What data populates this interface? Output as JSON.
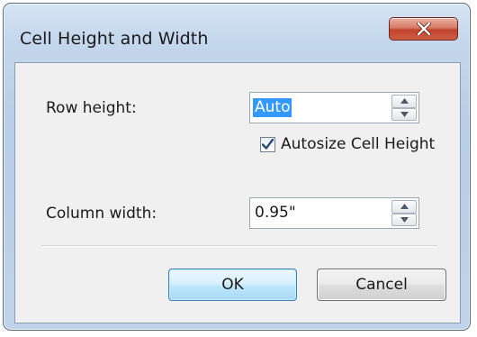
{
  "dialog": {
    "title": "Cell Height and Width"
  },
  "row_height": {
    "label": "Row height:",
    "value": "Auto",
    "selected": true
  },
  "autosize": {
    "label": "Autosize Cell Height",
    "checked": true
  },
  "column_width": {
    "label": "Column width:",
    "value": "0.95\""
  },
  "buttons": {
    "ok_label": "OK",
    "cancel_label": "Cancel"
  },
  "icons": {
    "close": "close-icon",
    "spin_up": "spin-up-icon",
    "spin_down": "spin-down-icon",
    "check": "checkmark-icon"
  },
  "colors": {
    "selection": "#3399ff",
    "close_button": "#c2432c",
    "default_button_border": "#3c7fb1"
  }
}
